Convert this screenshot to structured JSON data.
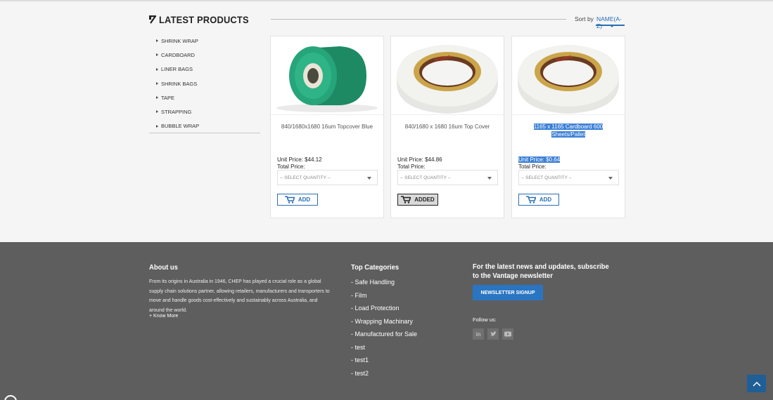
{
  "section": {
    "title": "LATEST PRODUCTS"
  },
  "sort": {
    "label": "Sort by",
    "value": "NAME(A-Z)"
  },
  "sidebar": {
    "items": [
      {
        "label": "SHRINK WRAP"
      },
      {
        "label": "CARDBOARD"
      },
      {
        "label": "LINER BAGS"
      },
      {
        "label": "SHRINK BAGS"
      },
      {
        "label": "TAPE"
      },
      {
        "label": "STRAPPING"
      },
      {
        "label": "BUBBLE WRAP"
      }
    ]
  },
  "products": [
    {
      "name": "840/1680x1680 16um Topcover Blue",
      "unit_price": "Unit Price: $44.12",
      "total_price": "Total Price:",
      "select_placeholder": "-- SELECT QUANTITY --",
      "button": "ADD",
      "image": "green-film-roll",
      "added": false,
      "highlight": false
    },
    {
      "name": "840/1680 x 1680 16um Top Cover",
      "unit_price": "Unit Price: $44.86",
      "total_price": "Total Price:",
      "select_placeholder": "-- SELECT QUANTITY --",
      "button": "ADDED",
      "image": "scotch-tape-roll",
      "added": true,
      "highlight": false
    },
    {
      "name": "1165 x 1165 Cardboard 600 Sheets/Pallet",
      "unit_price": "Unit Price: $0.64",
      "total_price": "Total Price:",
      "select_placeholder": "-- SELECT QUANTITY --",
      "button": "ADD",
      "image": "scotch-tape-roll",
      "added": false,
      "highlight": true
    }
  ],
  "footer": {
    "about": {
      "title": "About us",
      "text": "From its origins in Australia in 1946, CHEP has played a crucial role as a global supply chain solutions partner, allowing retailers, manufacturers and transporters to move and handle goods cost-effectively and sustainably across Australia, and around the world.",
      "more": "+ Know More"
    },
    "categories": {
      "title": "Top Categories",
      "items": [
        "- Safe Handling",
        "- Film",
        "- Load Protection",
        "- Wrapping Machinary",
        "- Manufactured for Sale",
        "- test",
        "- test1",
        "- test2"
      ]
    },
    "newsletter": {
      "title": "For the latest news and updates, subscribe to the Vantage newsletter",
      "button": "NEWSLETTER SIGNUP",
      "follow": "Follow us:",
      "social": [
        "linkedin-icon",
        "twitter-icon",
        "youtube-icon"
      ]
    }
  },
  "colors": {
    "accent": "#2a6fb5",
    "footer_bg": "#5e5e5e",
    "highlight": "#3b7fd6"
  }
}
